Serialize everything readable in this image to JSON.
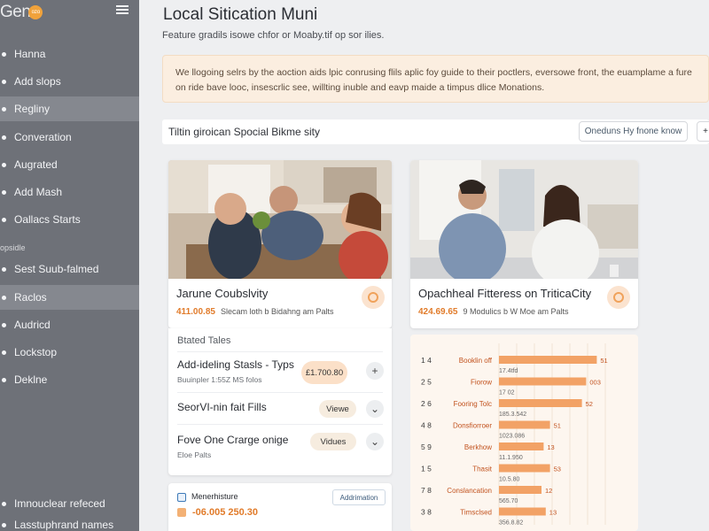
{
  "sidebar": {
    "brand": "Gen",
    "brand_badge": "ozo",
    "items": [
      {
        "label": "Hanna"
      },
      {
        "label": "Add slops"
      },
      {
        "label": "Regliny"
      },
      {
        "label": "Converation"
      },
      {
        "label": "Augrated"
      },
      {
        "label": "Add Mash"
      },
      {
        "label": "Oallacs Starts"
      }
    ],
    "section_label": "opsidle",
    "items2": [
      {
        "label": "Sest Suub-falmed"
      },
      {
        "label": "Raclos"
      },
      {
        "label": "Audricd"
      },
      {
        "label": "Lockstop"
      },
      {
        "label": "Deklne"
      }
    ],
    "footer": [
      {
        "label": "Imnouclear refeced"
      },
      {
        "label": "Lasstuphrand names"
      }
    ]
  },
  "header": {
    "title": "Local Sitication Muni",
    "subtitle": "Feature gradils isowe chfor or Moaby.tif op sor ilies."
  },
  "notice": {
    "text": "We llogoing selrs by the aoction aids lpic conrusing flils aplic foy guide to their poctlers, eversowe front, the euamplame a fure on ride bave looc, insescrlic see, willting inuble and eavp maide a timpus dlice Monations."
  },
  "search": {
    "value": "Tiltin giroican Spocial Bikme sity",
    "button_label": "Oneduns Hy fnone know",
    "extra_label": "+"
  },
  "cards": [
    {
      "title": "Jarune Coubslvity",
      "price": "411.00.85",
      "meta": "Slecam loth b Bidahng am Palts"
    },
    {
      "title": "Opachheal Fitteress on TriticaCity",
      "price": "424.69.65",
      "meta": "9 Modulics b W Moe am Palts"
    }
  ],
  "related": {
    "label": "Btated Tales",
    "rows": [
      {
        "title": "Add-ideling Stasls - Typs",
        "sub": "Buuinpler 1:55Z MS folos",
        "pill": "£1.700.80",
        "action": "+"
      },
      {
        "title": "SeorVI-nin fait Fills",
        "sub": "",
        "pill": "Viewe",
        "action": "⌄"
      },
      {
        "title": "Fove One Crarge onige",
        "sub": "Eloe Palts",
        "pill": "Vidues",
        "action": "⌄"
      }
    ]
  },
  "bottom_card": {
    "label": "Menerhisture",
    "button": "Addrimation",
    "price": "-06.005 250.30"
  },
  "chart_data": {
    "type": "bar",
    "title": "",
    "xlabel": "",
    "ylabel": "",
    "categories": [
      "1 4 Booklin off",
      "2 5 Fiorow",
      "2 6 Fooring Tolc",
      "4 8 Donsfiorroer",
      "5 9 Berkhow",
      "1 5 Thasit",
      "7 8 Conslancation",
      "3 8 Timsclsed"
    ],
    "sub_labels": [
      "17.4tfd",
      "17 02",
      "185.3.542",
      "1023.086",
      "11.1.950",
      "10.5.80",
      "565.70",
      "356.8.82"
    ],
    "value_labels": [
      "51",
      "003",
      "52",
      "51",
      "13",
      "53",
      "12",
      "13"
    ],
    "values": [
      92,
      82,
      78,
      48,
      42,
      48,
      40,
      44
    ],
    "xlim": [
      0,
      100
    ],
    "bar_color": "#f2a266"
  },
  "colors": {
    "accent": "#e17b2a",
    "sidebar_bg": "#6e7178",
    "notice_bg": "#fbeee0"
  }
}
